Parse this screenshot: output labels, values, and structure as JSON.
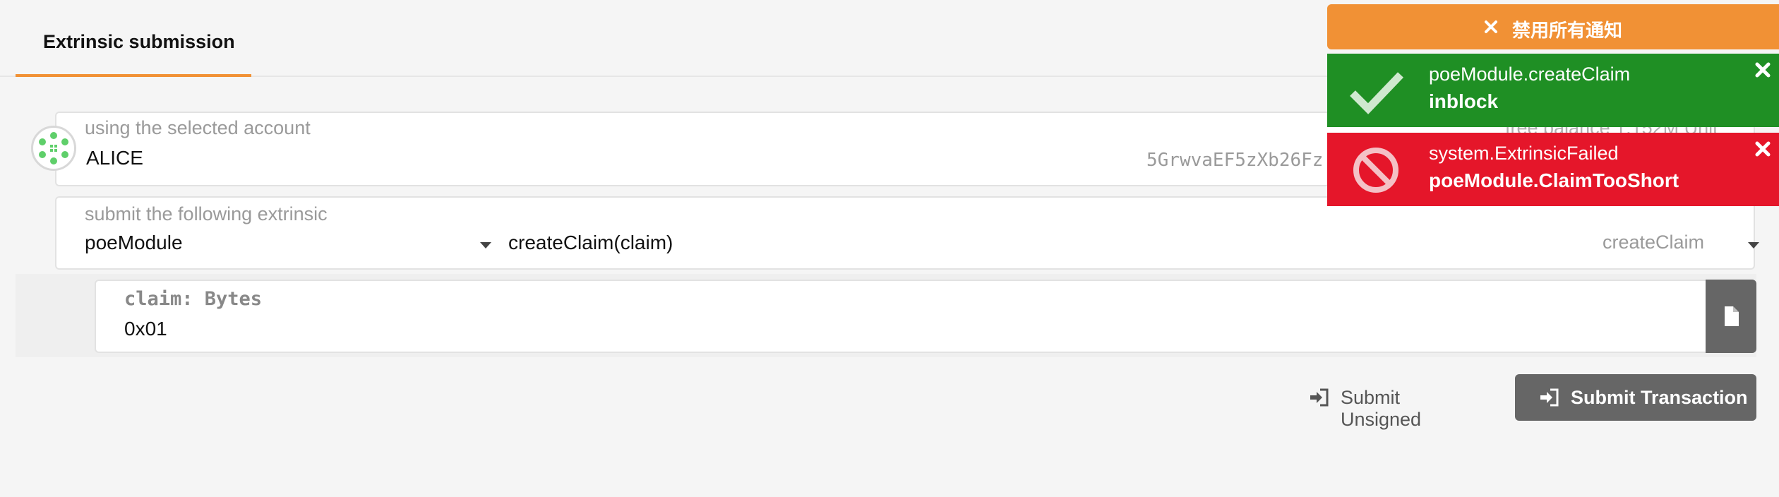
{
  "tab": {
    "label": "Extrinsic submission"
  },
  "account": {
    "label": "using the selected account",
    "name": "ALICE",
    "address": "5GrwvaEF5zXb26Fz",
    "balance_partial": "free balance 1.152M Unit"
  },
  "extrinsic": {
    "label": "submit the following extrinsic",
    "module": "poeModule",
    "call": "createClaim(claim)",
    "method": "createClaim"
  },
  "param": {
    "label": "claim: Bytes",
    "value": "0x01"
  },
  "buttons": {
    "unsigned": "Submit Unsigned",
    "submit": "Submit Transaction"
  },
  "notifications": {
    "disable_all": "禁用所有通知",
    "success": {
      "title": "poeModule.createClaim",
      "status": "inblock"
    },
    "error": {
      "title": "system.ExtrinsicFailed",
      "status": "poeModule.ClaimTooShort"
    }
  },
  "colors": {
    "accent": "#f19135",
    "success": "#1f8f24",
    "error": "#e5162a",
    "button": "#666666"
  }
}
